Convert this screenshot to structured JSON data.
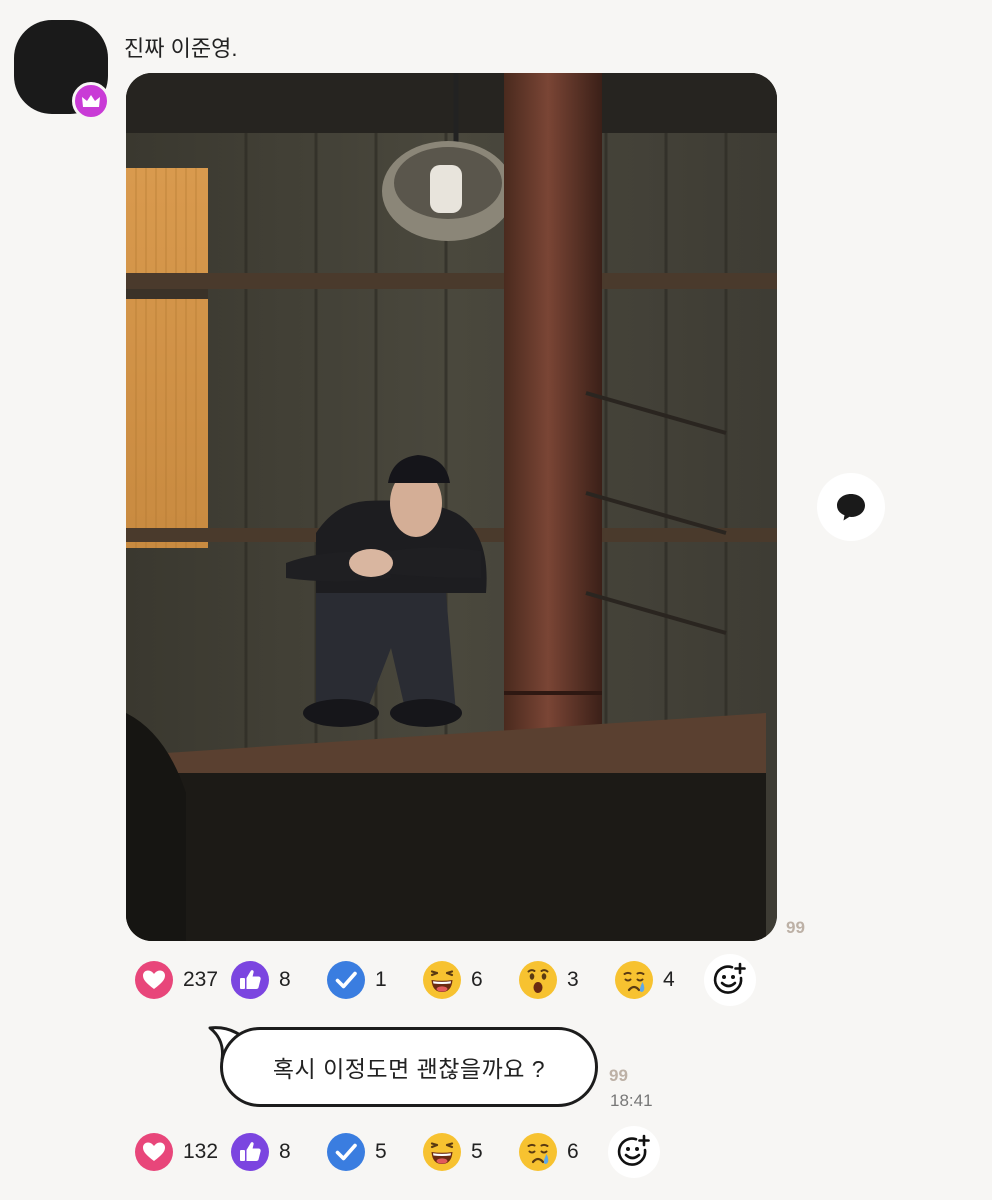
{
  "message": {
    "sender_name": "진짜 이준영.",
    "photo_read_count": "99",
    "photo_reactions": [
      {
        "icon": "heart-icon",
        "count": "237"
      },
      {
        "icon": "thumbs-up-icon",
        "count": "8"
      },
      {
        "icon": "check-icon",
        "count": "1"
      },
      {
        "icon": "laughing-face-icon",
        "count": "6"
      },
      {
        "icon": "surprised-face-icon",
        "count": "3"
      },
      {
        "icon": "sad-face-icon",
        "count": "4"
      }
    ],
    "text": "혹시 이정도면 괜찮을까요 ?",
    "text_read_count": "99",
    "text_time": "18:41",
    "text_reactions": [
      {
        "icon": "heart-icon",
        "count": "132"
      },
      {
        "icon": "thumbs-up-icon",
        "count": "8"
      },
      {
        "icon": "check-icon",
        "count": "5"
      },
      {
        "icon": "laughing-face-icon",
        "count": "5"
      },
      {
        "icon": "sad-face-icon",
        "count": "6"
      }
    ]
  },
  "colors": {
    "background": "#f7f6f4",
    "crown_badge": "#c93bd6",
    "heart": "#e8467a",
    "thumbs_up": "#7b45e0",
    "check": "#3a7de0",
    "emoji_yellow": "#f7c230",
    "read_count": "#bdb1a6"
  }
}
